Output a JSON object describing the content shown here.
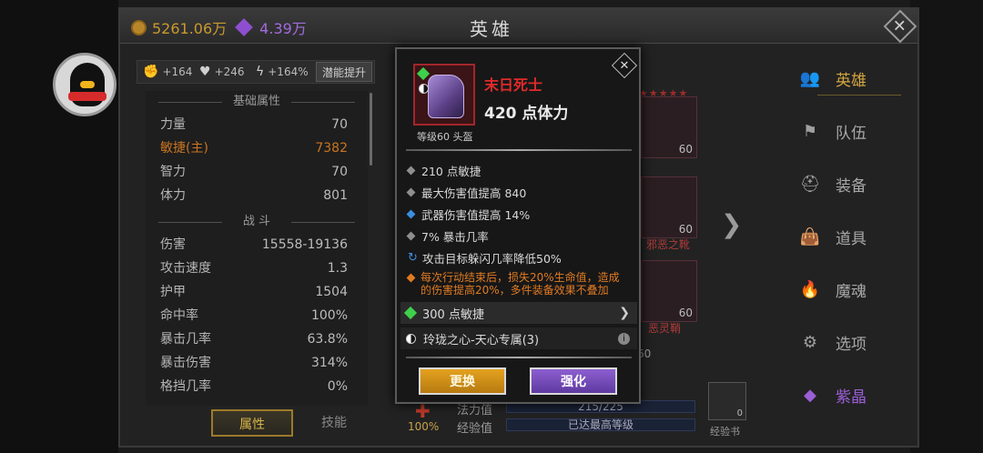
{
  "header": {
    "title": "英雄",
    "gold": "5261.06万",
    "crystal": "4.39万",
    "close_symbol": "✕"
  },
  "stat_bonus": {
    "str_bonus": "+164",
    "hp_bonus": "+246",
    "power_bonus": "+164%",
    "potential_button": "潜能提升"
  },
  "attributes": {
    "base_header": "基础属性",
    "base": [
      {
        "label": "力量",
        "value": "70"
      },
      {
        "label": "敏捷(主)",
        "value": "7382",
        "highlight": true
      },
      {
        "label": "智力",
        "value": "70"
      },
      {
        "label": "体力",
        "value": "801"
      }
    ],
    "combat_header": "战 斗",
    "combat": [
      {
        "label": "伤害",
        "value": "15558-19136"
      },
      {
        "label": "攻击速度",
        "value": "1.3"
      },
      {
        "label": "护甲",
        "value": "1504"
      },
      {
        "label": "命中率",
        "value": "100%"
      },
      {
        "label": "暴击几率",
        "value": "63.8%"
      },
      {
        "label": "暴击伤害",
        "value": "314%"
      },
      {
        "label": "格挡几率",
        "value": "0%"
      }
    ]
  },
  "tabs": [
    "属性",
    "技能"
  ],
  "nav": {
    "items": [
      {
        "label": "英雄",
        "icon": "heroes-icon"
      },
      {
        "label": "队伍",
        "icon": "flag-icon"
      },
      {
        "label": "装备",
        "icon": "helmet-icon"
      },
      {
        "label": "道具",
        "icon": "bag-icon"
      },
      {
        "label": "魔魂",
        "icon": "flame-icon"
      },
      {
        "label": "选项",
        "icon": "gear-icon"
      },
      {
        "label": "紫晶",
        "icon": "crystal-icon"
      }
    ]
  },
  "equipment": {
    "slot_levels": [
      "60",
      "60",
      "60"
    ],
    "slot_names": [
      "邪恶之靴",
      "恶灵鞘"
    ],
    "partial_number": "60"
  },
  "bottom": {
    "mana_label": "法力值",
    "mana_value": "215/225",
    "exp_label": "经验值",
    "exp_value": "已达最高等级",
    "percent": "100%",
    "exp_book_label": "经验书",
    "exp_book_count": "0"
  },
  "tooltip": {
    "close_symbol": "✕",
    "item_name": "末日死士",
    "main_stat": "420 点体力",
    "item_level_type": "等级60 头盔",
    "stats": [
      "210 点敏捷",
      "最大伤害值提高 840",
      "武器伤害值提高 14%",
      "7% 暴击几率",
      "攻击目标躲闪几率降低50%"
    ],
    "special_effect": "每次行动结束后，损失20%生命值，造成的伤害提高20%，多件装备效果不叠加",
    "gem_socket": "300 点敏捷",
    "set_bonus": "玲珑之心-天心专属(3)",
    "info_symbol": "i",
    "replace_button": "更换",
    "enhance_button": "强化"
  },
  "colors": {
    "item_name_red": "#e02a2a",
    "special_orange": "#e07b22",
    "gold_accent": "#d4a640",
    "purple_accent": "#9b5fd6",
    "gem_green": "#3ed04b"
  }
}
